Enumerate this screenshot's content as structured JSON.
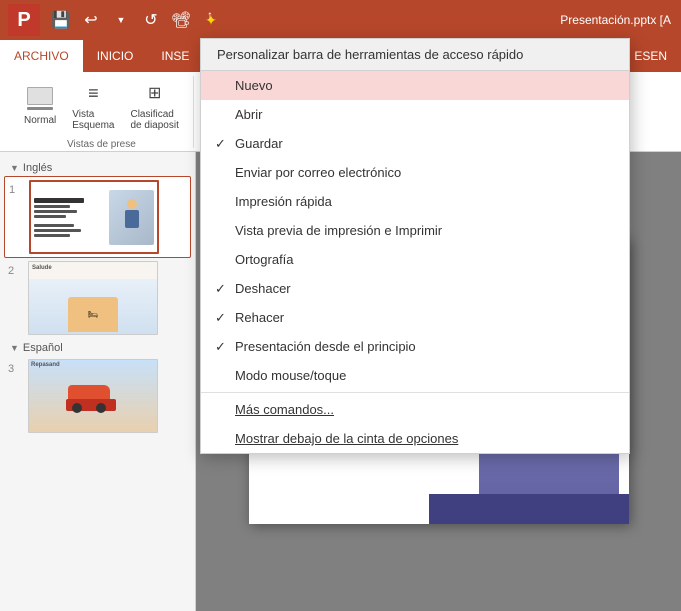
{
  "titlebar": {
    "filename": "Presentación.pptx [A",
    "logo": "P"
  },
  "ribbon": {
    "tabs": [
      "ARCHIVO",
      "INICIO",
      "INSE",
      "ESEN"
    ],
    "active_tab": "ARCHIVO",
    "views_group_label": "Vistas de prese",
    "views_buttons": [
      "Normal",
      "Vista Esquema",
      "Clasificad de diaposit"
    ],
    "views_subtext": [
      "",
      "",
      ""
    ]
  },
  "slide_panel": {
    "sections": [
      {
        "name": "Inglés",
        "slides": [
          1,
          2
        ]
      },
      {
        "name": "Español",
        "slides": [
          3
        ]
      }
    ]
  },
  "dropdown": {
    "header": "Personalizar barra de herramientas de acceso rápido",
    "items": [
      {
        "label": "Nuevo",
        "checked": false,
        "highlighted": true,
        "underline_char": ""
      },
      {
        "label": "Abrir",
        "checked": false,
        "highlighted": false,
        "underline_char": ""
      },
      {
        "label": "Guardar",
        "checked": true,
        "highlighted": false,
        "underline_char": ""
      },
      {
        "label": "Enviar por correo electrónico",
        "checked": false,
        "highlighted": false,
        "underline_char": ""
      },
      {
        "label": "Impresión rápida",
        "checked": false,
        "highlighted": false,
        "underline_char": ""
      },
      {
        "label": "Vista previa de impresión e Imprimir",
        "checked": false,
        "highlighted": false,
        "underline_char": ""
      },
      {
        "label": "Ortografía",
        "checked": false,
        "highlighted": false,
        "underline_char": ""
      },
      {
        "label": "Deshacer",
        "checked": true,
        "highlighted": false,
        "underline_char": ""
      },
      {
        "label": "Rehacer",
        "checked": true,
        "highlighted": false,
        "underline_char": ""
      },
      {
        "label": "Presentación desde el principio",
        "checked": true,
        "highlighted": false,
        "underline_char": ""
      },
      {
        "label": "Modo mouse/toque",
        "checked": false,
        "highlighted": false,
        "underline_char": ""
      },
      {
        "label": "Más comandos...",
        "checked": false,
        "highlighted": false,
        "underline_char": "á"
      },
      {
        "label": "Mostrar debajo de la cinta de opciones",
        "checked": false,
        "highlighted": false,
        "underline_char": "o"
      }
    ]
  },
  "normal_text": "Normal"
}
